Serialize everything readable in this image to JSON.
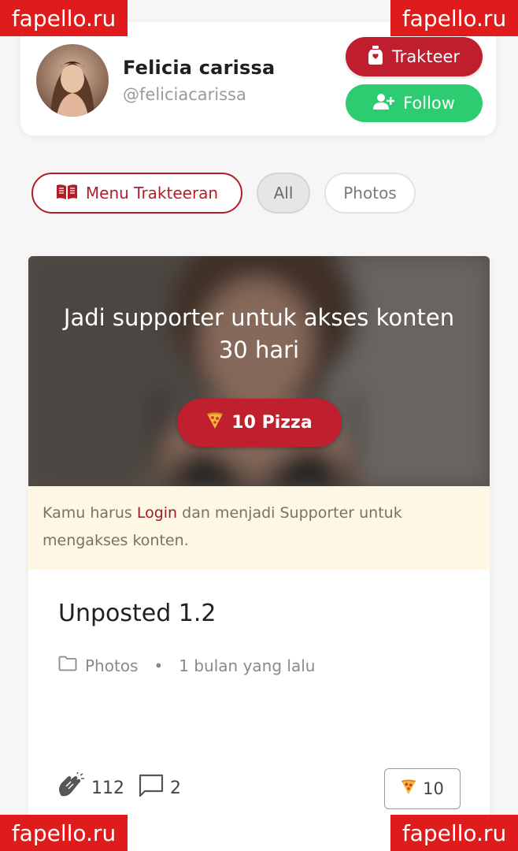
{
  "profile": {
    "name": "Felicia carissa",
    "username": "@feliciacarissa",
    "trakteer_label": "Trakteer",
    "follow_label": "Follow"
  },
  "filters": {
    "menu_label": "Menu Trakteeran",
    "all_label": "All",
    "photos_label": "Photos",
    "active": "All"
  },
  "post": {
    "locked_title": "Jadi supporter untuk akses konten 30 hari",
    "unlock_price_label": "10 Pizza",
    "login_note_before": "Kamu harus ",
    "login_link": "Login",
    "login_note_after": " dan menjadi Supporter untuk mengakses konten.",
    "title": "Unposted 1.2",
    "category": "Photos",
    "separator": "•",
    "time": "1 bulan yang lalu",
    "likes": "112",
    "comments": "2",
    "tip_count": "10"
  },
  "watermark": {
    "text": "fapello.ru"
  },
  "colors": {
    "brand_red": "#be1e2d",
    "follow_green": "#2ecc71",
    "note_bg": "#fdf7e4",
    "watermark_red": "#e01b1b"
  },
  "icons": {
    "trakteer": "trakteer-jar-icon",
    "follow": "add-user-icon",
    "menu": "book-icon",
    "pizza": "pizza-icon",
    "folder": "folder-icon",
    "likes": "clap-icon",
    "comments": "comment-icon"
  }
}
